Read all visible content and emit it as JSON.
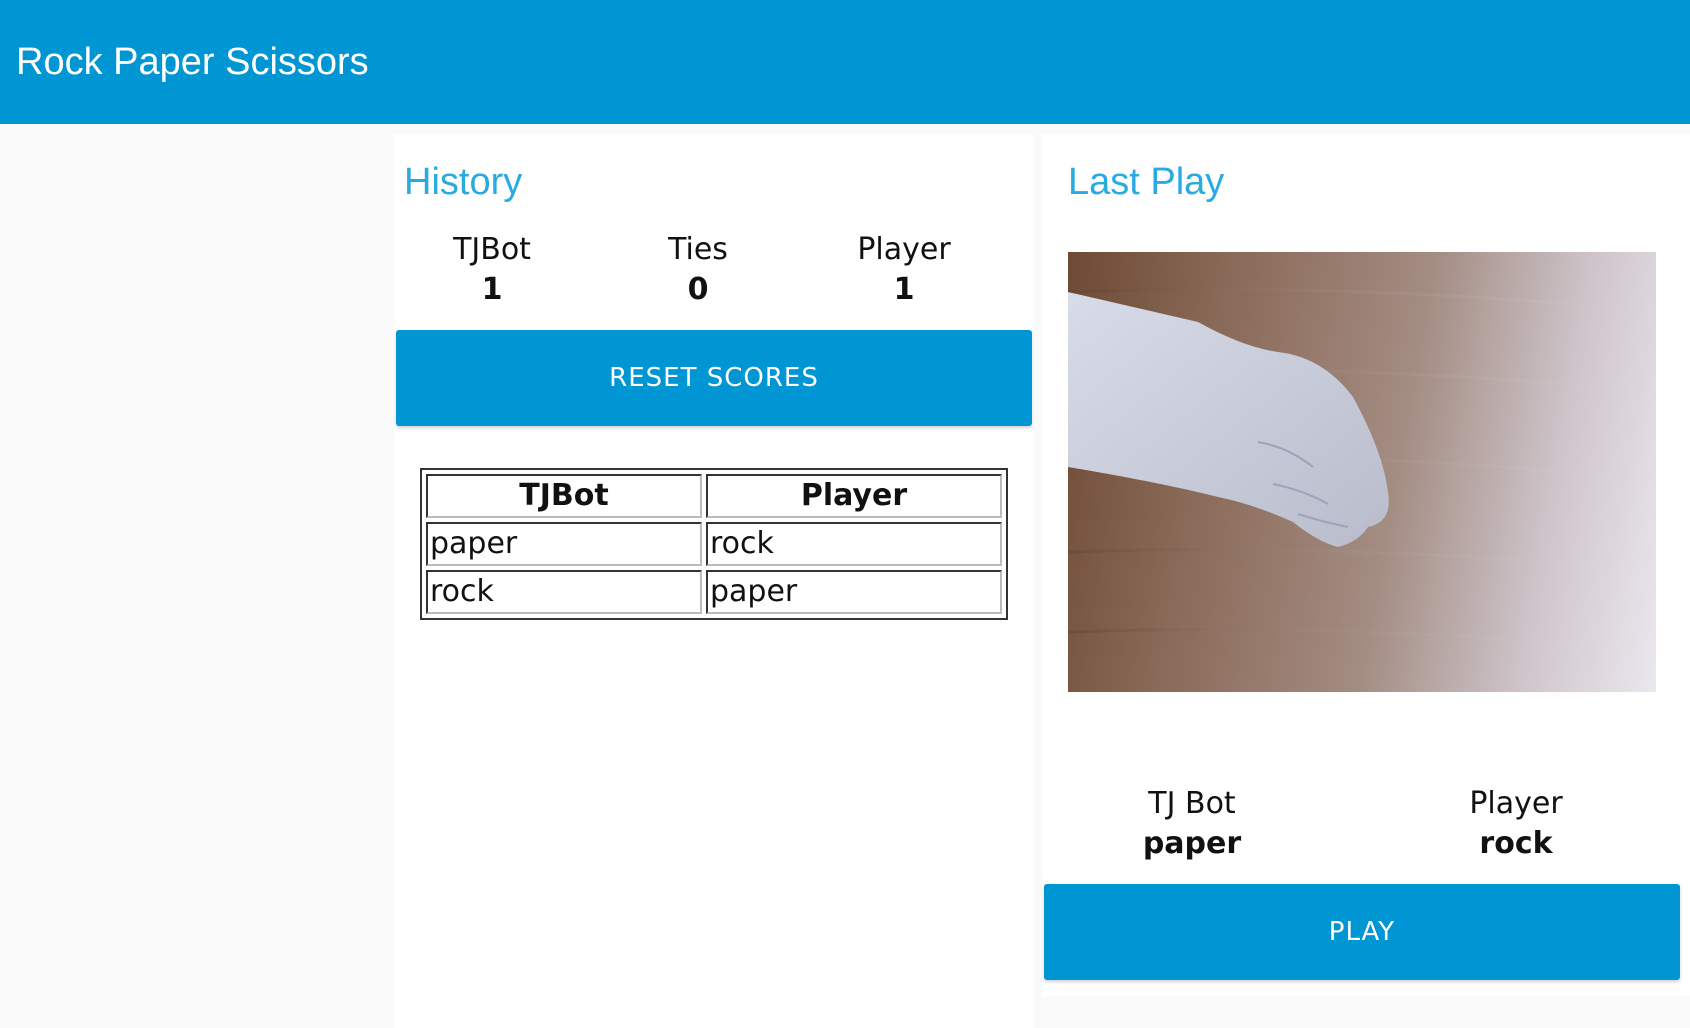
{
  "app": {
    "title": "Rock Paper Scissors"
  },
  "history": {
    "title": "History",
    "scores": {
      "tjbot": {
        "label": "TJBot",
        "value": "1"
      },
      "ties": {
        "label": "Ties",
        "value": "0"
      },
      "player": {
        "label": "Player",
        "value": "1"
      }
    },
    "reset_button": "RESET SCORES",
    "table": {
      "headers": [
        "TJBot",
        "Player"
      ],
      "rows": [
        [
          "paper",
          "rock"
        ],
        [
          "rock",
          "paper"
        ]
      ]
    }
  },
  "last_play": {
    "title": "Last Play",
    "tjbot": {
      "label": "TJ Bot",
      "value": "paper"
    },
    "player": {
      "label": "Player",
      "value": "rock"
    },
    "play_button": "PLAY"
  },
  "colors": {
    "header": "#0095d3",
    "accent_title": "#29abe2",
    "button": "#0095d3",
    "button_text": "#ffffff",
    "page_bg": "#fafafa",
    "panel_bg": "#ffffff"
  },
  "icons": {
    "photo": "rock-hand-photo"
  }
}
